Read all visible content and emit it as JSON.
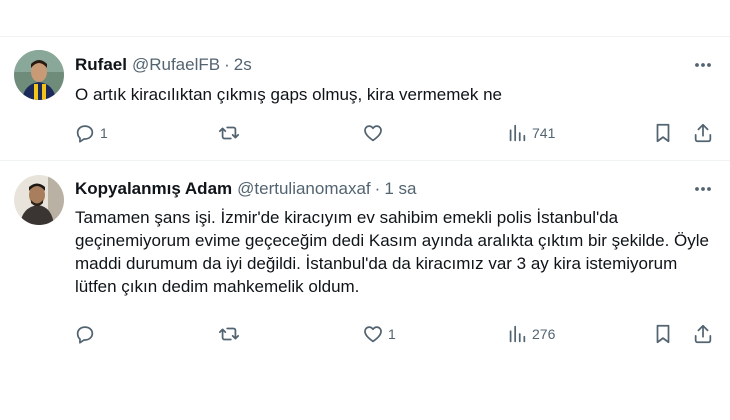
{
  "tweets": [
    {
      "name": "Rufael",
      "handle": "@RufaelFB",
      "separator": "·",
      "time": "2s",
      "text": "O artık kiracılıktan çıkmış gaps olmuş, kira vermemek ne",
      "actions": {
        "reply": "1",
        "retweet": "",
        "like": "",
        "views": "741"
      },
      "icons": [
        "reply-icon",
        "retweet-icon",
        "like-icon",
        "views-icon",
        "bookmark-icon",
        "share-icon"
      ]
    },
    {
      "name": "Kopyalanmış Adam",
      "handle": "@tertulianomaxaf",
      "separator": "·",
      "time": "1 sa",
      "text": "Tamamen şans işi. İzmir'de kiracıyım ev sahibim emekli polis İstanbul'da geçinemiyorum evime geçeceğim dedi Kasım ayında aralıkta çıktım bir şekilde. Öyle maddi durumum da iyi değildi. İstanbul'da da kiracımız var 3 ay kira istemiyorum lütfen çıkın dedim mahkemelik oldum.",
      "actions": {
        "reply": "",
        "retweet": "",
        "like": "1",
        "views": "276"
      },
      "icons": [
        "reply-icon",
        "retweet-icon",
        "like-icon",
        "views-icon",
        "bookmark-icon",
        "share-icon"
      ]
    }
  ],
  "colors": {
    "text": "#0f1419",
    "secondary": "#536471",
    "border": "#eff3f4"
  }
}
